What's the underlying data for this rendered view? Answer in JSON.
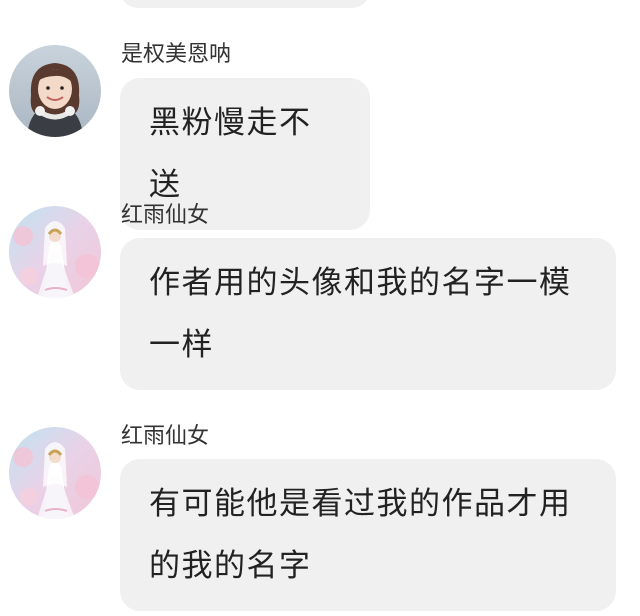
{
  "messages": [
    {
      "sender": "是权美恩呐",
      "text": "黑粉慢走不送",
      "avatar": "girl-photo-avatar"
    },
    {
      "sender": "红雨仙女",
      "text": "作者用的头像和我的名字一模一样",
      "avatar": "fairy-illustration-avatar"
    },
    {
      "sender": "红雨仙女",
      "text": "有可能他是看过我的作品才用的我的名字",
      "avatar": "fairy-illustration-avatar"
    }
  ],
  "colors": {
    "bubble": "#f0f0f0",
    "sender_text": "#333333",
    "message_text": "#222222"
  }
}
